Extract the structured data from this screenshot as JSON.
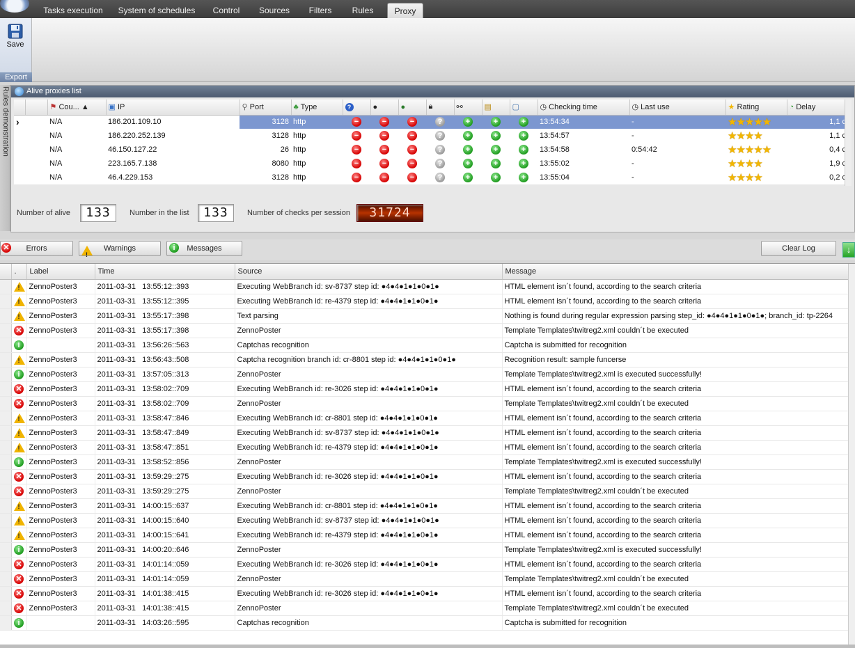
{
  "tabs": [
    {
      "label": "Tasks execution",
      "active": false
    },
    {
      "label": "System of schedules",
      "active": false
    },
    {
      "label": "Control",
      "active": false
    },
    {
      "label": "Sources",
      "active": false
    },
    {
      "label": "Filters",
      "active": false
    },
    {
      "label": "Rules",
      "active": false
    },
    {
      "label": "Proxy",
      "active": true
    }
  ],
  "ribbon": {
    "save_label": "Save",
    "group_label": "Export"
  },
  "sidetab": {
    "label": "Rules demonstration"
  },
  "proxy_panel": {
    "title": "Alive proxies list",
    "columns": {
      "country": "Cou... ▲",
      "ip": "IP",
      "port": "Port",
      "type": "Type",
      "checking_time": "Checking time",
      "last_use": "Last use",
      "rating": "Rating",
      "delay": "Delay"
    },
    "rows": [
      {
        "country": "N/A",
        "ip": "186.201.109.10",
        "port": "3128",
        "type": "http",
        "checks": [
          "red",
          "red",
          "red",
          "grey",
          "green",
          "green",
          "green"
        ],
        "checking_time": "13:54:34",
        "last_use": "-",
        "rating": "★★★★★",
        "delay": "1,1 c",
        "selected": true
      },
      {
        "country": "N/A",
        "ip": "186.220.252.139",
        "port": "3128",
        "type": "http",
        "checks": [
          "red",
          "red",
          "red",
          "grey",
          "green",
          "green",
          "green"
        ],
        "checking_time": "13:54:57",
        "last_use": "-",
        "rating": "★★★★",
        "delay": "1,1 c",
        "selected": false
      },
      {
        "country": "N/A",
        "ip": "46.150.127.22",
        "port": "26",
        "type": "http",
        "checks": [
          "red",
          "red",
          "red",
          "grey",
          "green",
          "green",
          "green"
        ],
        "checking_time": "13:54:58",
        "last_use": "0:54:42",
        "rating": "★★★★★",
        "delay": "0,4 c",
        "selected": false
      },
      {
        "country": "N/A",
        "ip": "223.165.7.138",
        "port": "8080",
        "type": "http",
        "checks": [
          "red",
          "red",
          "red",
          "grey",
          "green",
          "green",
          "green"
        ],
        "checking_time": "13:55:02",
        "last_use": "-",
        "rating": "★★★★",
        "delay": "1,9 c",
        "selected": false
      },
      {
        "country": "N/A",
        "ip": "46.4.229.153",
        "port": "3128",
        "type": "http",
        "checks": [
          "red",
          "red",
          "red",
          "grey",
          "green",
          "green",
          "green"
        ],
        "checking_time": "13:55:04",
        "last_use": "-",
        "rating": "★★★★",
        "delay": "0,2 c",
        "selected": false
      }
    ],
    "counters": {
      "alive_label": "Number of alive",
      "alive_value": "133",
      "list_label": "Number in the list",
      "list_value": "133",
      "checks_label": "Number of checks per session",
      "checks_value": "31724"
    }
  },
  "log_toolbar": {
    "errors_label": "Errors",
    "warnings_label": "Warnings",
    "messages_label": "Messages",
    "clear_label": "Clear Log"
  },
  "log": {
    "columns": {
      "dot": ".",
      "label": "Label",
      "time": "Time",
      "source": "Source",
      "message": "Message"
    },
    "rows": [
      {
        "kind": "warning",
        "label": "ZennoPoster3",
        "time": "2011-03-31   13:55:12::393",
        "source": "Executing WebBranch id: sv-8737 step id: ●4●4●1●1●0●1●",
        "message": "HTML element isn´t found, according to the search criteria"
      },
      {
        "kind": "warning",
        "label": "ZennoPoster3",
        "time": "2011-03-31   13:55:12::395",
        "source": "Executing WebBranch id: re-4379 step id: ●4●4●1●1●0●1●",
        "message": "HTML element isn´t found, according to the search criteria"
      },
      {
        "kind": "warning",
        "label": "ZennoPoster3",
        "time": "2011-03-31   13:55:17::398",
        "source": "Text parsing",
        "message": "Nothing is found during regular expression parsing  step_id: ●4●4●1●1●0●1●; branch_id: tp-2264"
      },
      {
        "kind": "error",
        "label": "ZennoPoster3",
        "time": "2011-03-31   13:55:17::398",
        "source": "ZennoPoster",
        "message": "Template Templates\\twitreg2.xml couldn´t be executed"
      },
      {
        "kind": "info",
        "label": "",
        "time": "2011-03-31   13:56:26::563",
        "source": "Captchas recognition",
        "message": "Captcha is submitted for recognition"
      },
      {
        "kind": "warning",
        "label": "ZennoPoster3",
        "time": "2011-03-31   13:56:43::508",
        "source": "Captcha recognition branch id: cr-8801 step id: ●4●4●1●1●0●1●",
        "message": "Recognition result: sample funcerse"
      },
      {
        "kind": "info",
        "label": "ZennoPoster3",
        "time": "2011-03-31   13:57:05::313",
        "source": "ZennoPoster",
        "message": "Template Templates\\twitreg2.xml is executed successfully!"
      },
      {
        "kind": "error",
        "label": "ZennoPoster3",
        "time": "2011-03-31   13:58:02::709",
        "source": "Executing WebBranch id: re-3026 step id: ●4●4●1●1●0●1●",
        "message": "HTML element isn´t found, according to the search criteria"
      },
      {
        "kind": "error",
        "label": "ZennoPoster3",
        "time": "2011-03-31   13:58:02::709",
        "source": "ZennoPoster",
        "message": "Template Templates\\twitreg2.xml couldn´t be executed"
      },
      {
        "kind": "warning",
        "label": "ZennoPoster3",
        "time": "2011-03-31   13:58:47::846",
        "source": "Executing WebBranch id: cr-8801 step id: ●4●4●1●1●0●1●",
        "message": "HTML element isn´t found, according to the search criteria"
      },
      {
        "kind": "warning",
        "label": "ZennoPoster3",
        "time": "2011-03-31   13:58:47::849",
        "source": "Executing WebBranch id: sv-8737 step id: ●4●4●1●1●0●1●",
        "message": "HTML element isn´t found, according to the search criteria"
      },
      {
        "kind": "warning",
        "label": "ZennoPoster3",
        "time": "2011-03-31   13:58:47::851",
        "source": "Executing WebBranch id: re-4379 step id: ●4●4●1●1●0●1●",
        "message": "HTML element isn´t found, according to the search criteria"
      },
      {
        "kind": "info",
        "label": "ZennoPoster3",
        "time": "2011-03-31   13:58:52::856",
        "source": "ZennoPoster",
        "message": "Template Templates\\twitreg2.xml is executed successfully!"
      },
      {
        "kind": "error",
        "label": "ZennoPoster3",
        "time": "2011-03-31   13:59:29::275",
        "source": "Executing WebBranch id: re-3026 step id: ●4●4●1●1●0●1●",
        "message": "HTML element isn´t found, according to the search criteria"
      },
      {
        "kind": "error",
        "label": "ZennoPoster3",
        "time": "2011-03-31   13:59:29::275",
        "source": "ZennoPoster",
        "message": "Template Templates\\twitreg2.xml couldn´t be executed"
      },
      {
        "kind": "warning",
        "label": "ZennoPoster3",
        "time": "2011-03-31   14:00:15::637",
        "source": "Executing WebBranch id: cr-8801 step id: ●4●4●1●1●0●1●",
        "message": "HTML element isn´t found, according to the search criteria"
      },
      {
        "kind": "warning",
        "label": "ZennoPoster3",
        "time": "2011-03-31   14:00:15::640",
        "source": "Executing WebBranch id: sv-8737 step id: ●4●4●1●1●0●1●",
        "message": "HTML element isn´t found, according to the search criteria"
      },
      {
        "kind": "warning",
        "label": "ZennoPoster3",
        "time": "2011-03-31   14:00:15::641",
        "source": "Executing WebBranch id: re-4379 step id: ●4●4●1●1●0●1●",
        "message": "HTML element isn´t found, according to the search criteria"
      },
      {
        "kind": "info",
        "label": "ZennoPoster3",
        "time": "2011-03-31   14:00:20::646",
        "source": "ZennoPoster",
        "message": "Template Templates\\twitreg2.xml is executed successfully!"
      },
      {
        "kind": "error",
        "label": "ZennoPoster3",
        "time": "2011-03-31   14:01:14::059",
        "source": "Executing WebBranch id: re-3026 step id: ●4●4●1●1●0●1●",
        "message": "HTML element isn´t found, according to the search criteria"
      },
      {
        "kind": "error",
        "label": "ZennoPoster3",
        "time": "2011-03-31   14:01:14::059",
        "source": "ZennoPoster",
        "message": "Template Templates\\twitreg2.xml couldn´t be executed"
      },
      {
        "kind": "error",
        "label": "ZennoPoster3",
        "time": "2011-03-31   14:01:38::415",
        "source": "Executing WebBranch id: re-3026 step id: ●4●4●1●1●0●1●",
        "message": "HTML element isn´t found, according to the search criteria"
      },
      {
        "kind": "error",
        "label": "ZennoPoster3",
        "time": "2011-03-31   14:01:38::415",
        "source": "ZennoPoster",
        "message": "Template Templates\\twitreg2.xml couldn´t be executed"
      },
      {
        "kind": "info",
        "label": "",
        "time": "2011-03-31   14:03:26::595",
        "source": "Captchas recognition",
        "message": "Captcha is submitted for recognition"
      }
    ]
  }
}
